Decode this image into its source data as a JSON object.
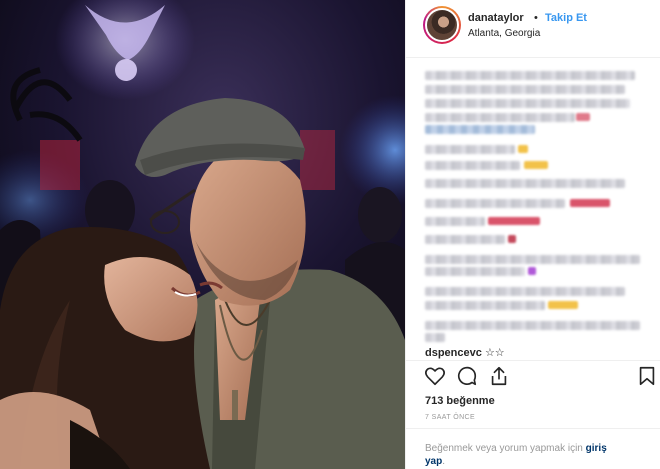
{
  "header": {
    "username": "danataylor",
    "dot": "•",
    "follow_label": "Takip Et",
    "location": "Atlanta, Georgia"
  },
  "comments": {
    "visible_username": "dspencevc",
    "visible_text": "☆☆"
  },
  "actions": {
    "icons": [
      "heart-icon",
      "comment-icon",
      "share-icon",
      "bookmark-icon"
    ]
  },
  "likes": "713 beğenme",
  "time": "7 SAAT ÖNCE",
  "login": {
    "prefix": "Beğenmek veya yorum yapmak için",
    "link1": "giriş",
    "link2": "yap",
    "suffix": "."
  },
  "colors": {
    "link_blue": "#3897f0",
    "dark_link": "#003569",
    "text": "#262626",
    "muted": "#999999"
  }
}
